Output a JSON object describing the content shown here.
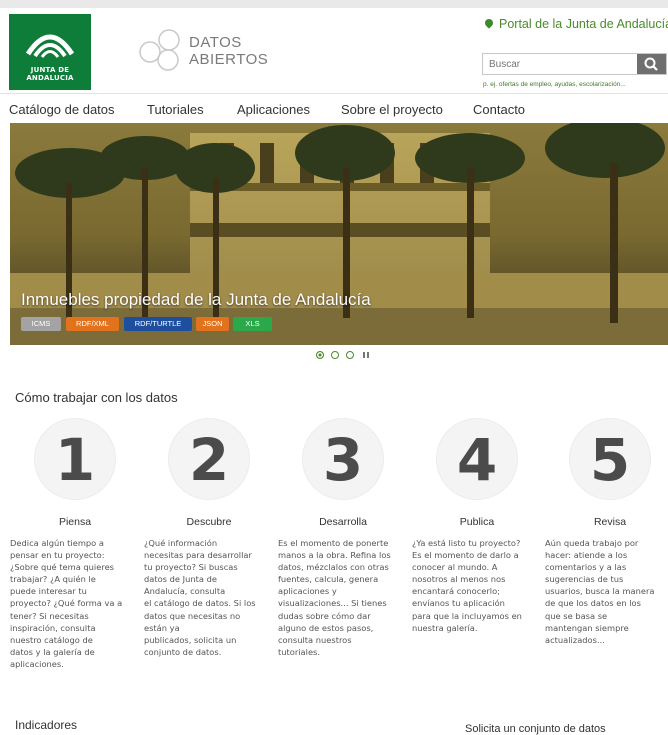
{
  "header": {
    "logo_text": "JUNTA DE ANDALUCIA",
    "brand_line1": "DATOS",
    "brand_line2": "ABIERTOS",
    "portal_link": "Portal de la Junta de Andalucía",
    "search_placeholder": "Buscar",
    "search_hint": "p. ej. ofertas de empleo, ayudas, escolarización..."
  },
  "nav": {
    "items": [
      "Catálogo de datos",
      "Tutoriales",
      "Aplicaciones",
      "Sobre el proyecto",
      "Contacto"
    ]
  },
  "hero": {
    "title": "Inmuebles propiedad de la Junta de Andalucía",
    "tags": [
      {
        "label": "ICMS",
        "color": "#a3a3a3"
      },
      {
        "label": "RDF/XML",
        "color": "#e2721c"
      },
      {
        "label": "RDF/TURTLE",
        "color": "#1d4f9e"
      },
      {
        "label": "JSON",
        "color": "#e2721c"
      },
      {
        "label": "XLS",
        "color": "#2aa84a"
      }
    ]
  },
  "section": {
    "title": "Cómo trabajar con los datos",
    "steps": [
      {
        "number": "1",
        "title": "Piensa",
        "text": "Dedica algún tiempo a\npensar en tu proyecto:\n¿Sobre qué tema quieres\ntrabajar? ¿A quién le\npuede interesar tu\nproyecto? ¿Qué forma va a\ntener? Si necesitas\ninspiración, consulta\nnuestro catálogo de\ndatos y la galería de\naplicaciones."
      },
      {
        "number": "2",
        "title": "Descubre",
        "text": "¿Qué información\nnecesitas para desarrollar\ntu proyecto? Si buscas\ndatos de Junta de\nAndalucía, consulta\nel catálogo de datos. Si los\ndatos que necesitas no\nestán ya\npublicados, solicita un\nconjunto de datos."
      },
      {
        "number": "3",
        "title": "Desarrolla",
        "text": "Es el momento de ponerte\nmanos a la obra. Refina los\ndatos, mézclalos con otras\nfuentes, calcula, genera\naplicaciones y\nvisualizaciones...  Si tienes\ndudas sobre cómo dar\nalguno de estos pasos,\nconsulta nuestros\ntutoriales."
      },
      {
        "number": "4",
        "title": "Publica",
        "text": "¿Ya está listo tu proyecto?\nEs el momento de darlo a\nconocer al mundo. A\nnosotros al menos nos\nencantará conocerlo;\nenvíanos tu aplicación\npara que la incluyamos en\nnuestra galería."
      },
      {
        "number": "5",
        "title": "Revisa",
        "text": "Aún queda trabajo por\nhacer: atiende a los\ncomentarios y a las\nsugerencias de tus\nusuarios, busca la manera\nde que los datos en los\nque se basa se\nmantengan siempre\nactualizados..."
      }
    ]
  },
  "footer_sections": {
    "indicators": "Indicadores",
    "request": "Solicita un conjunto de datos"
  }
}
